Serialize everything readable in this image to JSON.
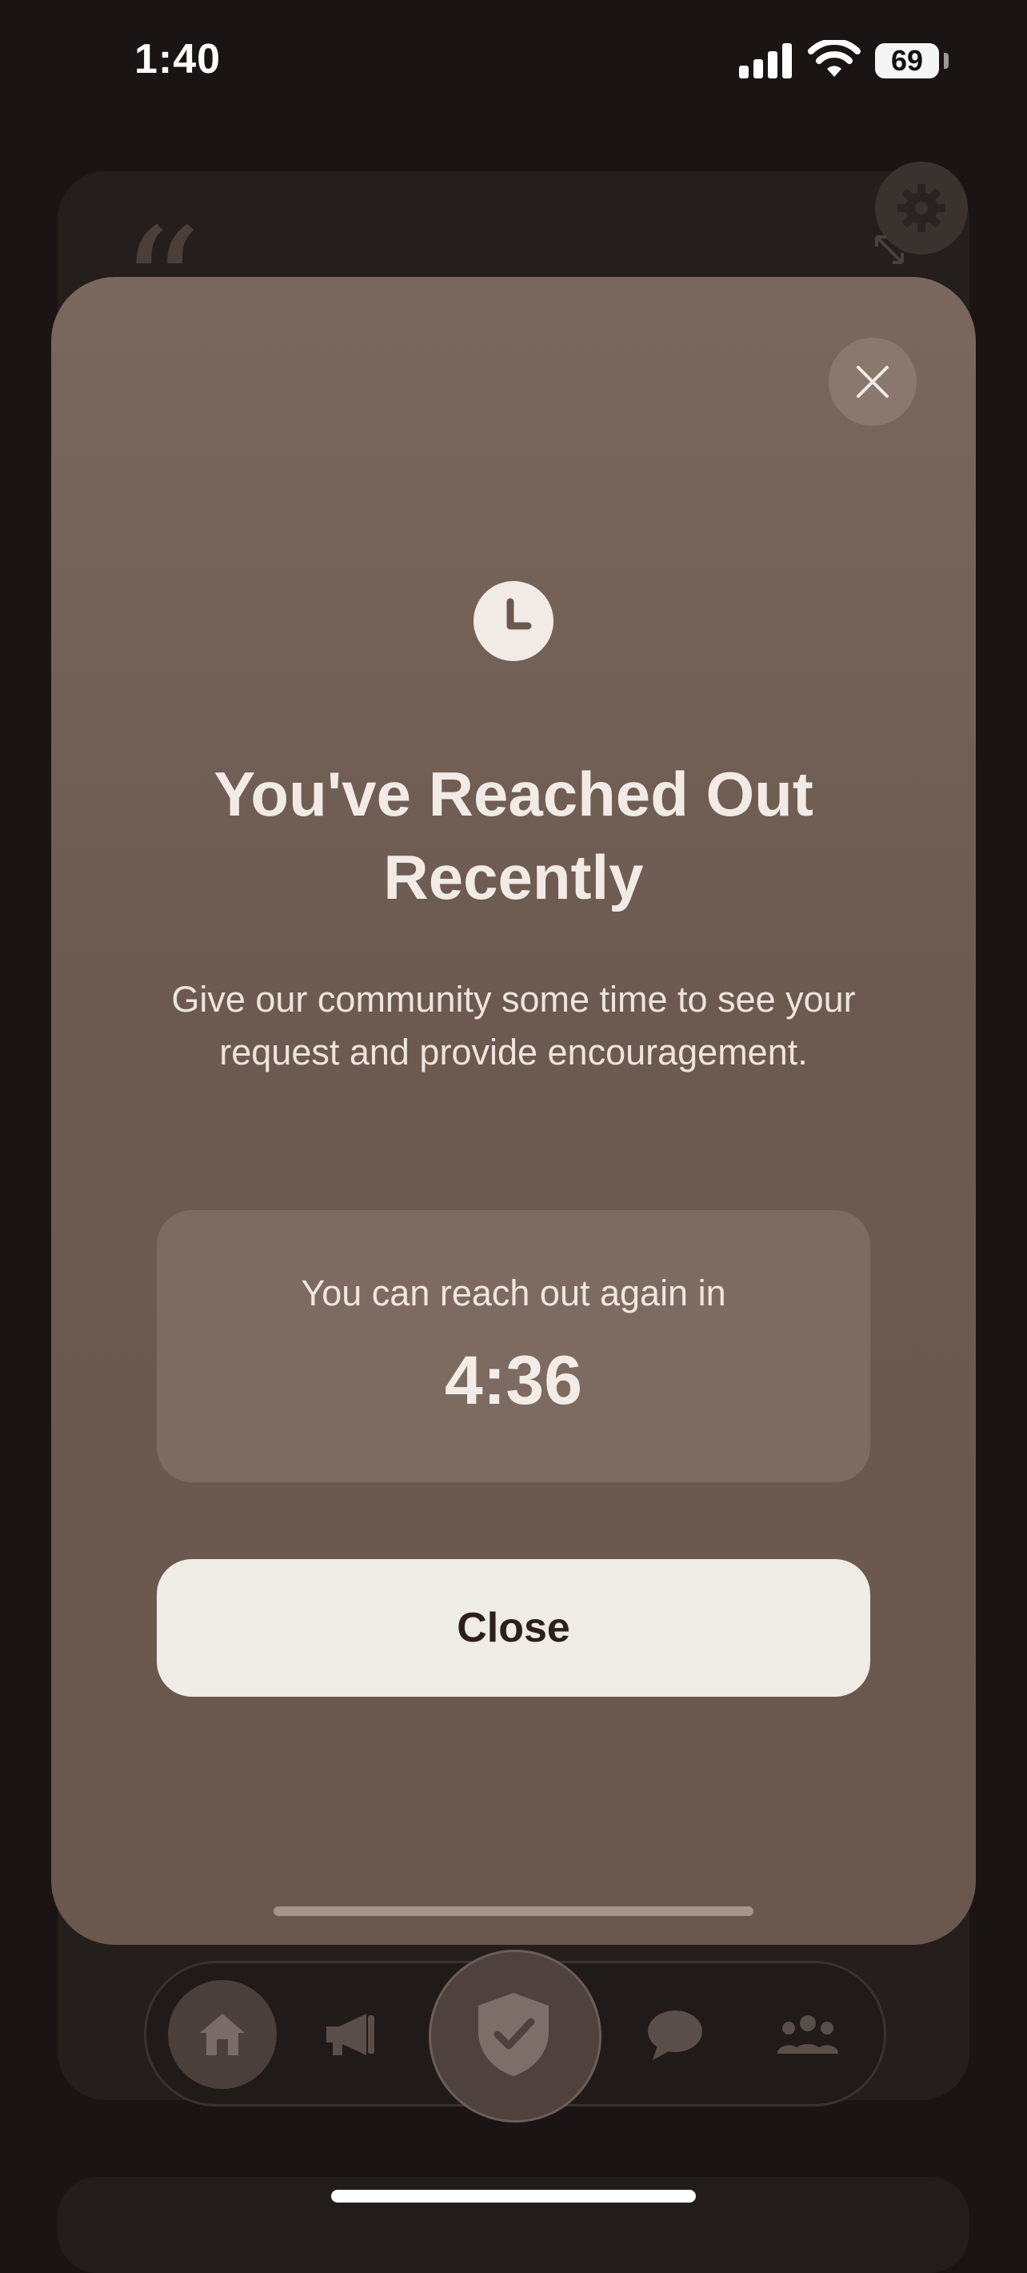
{
  "status_bar": {
    "time": "1:40",
    "battery": "69"
  },
  "modal": {
    "title": "You've Reached Out Recently",
    "message": "Give our community some time to see your request and provide encouragement.",
    "countdown_label": "You can reach out again in",
    "countdown_time": "4:36",
    "close_label": "Close"
  },
  "background": {
    "quote_mark": "“"
  },
  "icons": {
    "status": [
      "signal-icon",
      "wifi-icon",
      "battery-icon"
    ],
    "background": [
      "quote-icon",
      "gear-icon",
      "expand-icon"
    ],
    "nav": [
      "home-icon",
      "megaphone-icon",
      "shield-check-icon",
      "chat-bubble-icon",
      "people-icon"
    ],
    "modal": [
      "close-icon",
      "clock-icon"
    ]
  },
  "colors": {
    "modal_bg": "#6c5a51",
    "button_bg": "#efebe5",
    "text_light": "#f2ebe5",
    "screen_bg": "#1a1514"
  }
}
